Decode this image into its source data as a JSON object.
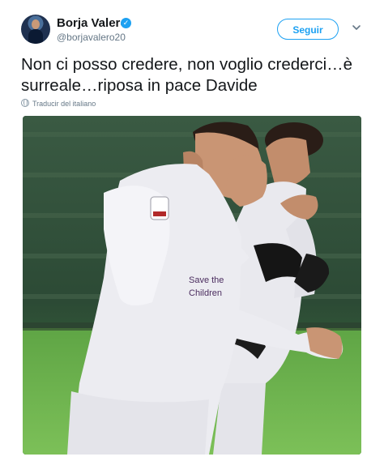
{
  "tweet": {
    "display_name": "Borja Valero",
    "handle": "@borjavalero20",
    "follow_label": "Seguir",
    "text": "Non ci posso credere, non voglio crederci…è surreale…riposa in pace Davide",
    "translate_label": "Traducir del italiano"
  },
  "photo": {
    "shirt_text": "Save the Children"
  },
  "colors": {
    "accent": "#1da1f2",
    "text_primary": "#14171a",
    "text_secondary": "#657786"
  },
  "icons": [
    "verified-badge-icon",
    "chevron-down-icon",
    "globe-icon"
  ]
}
